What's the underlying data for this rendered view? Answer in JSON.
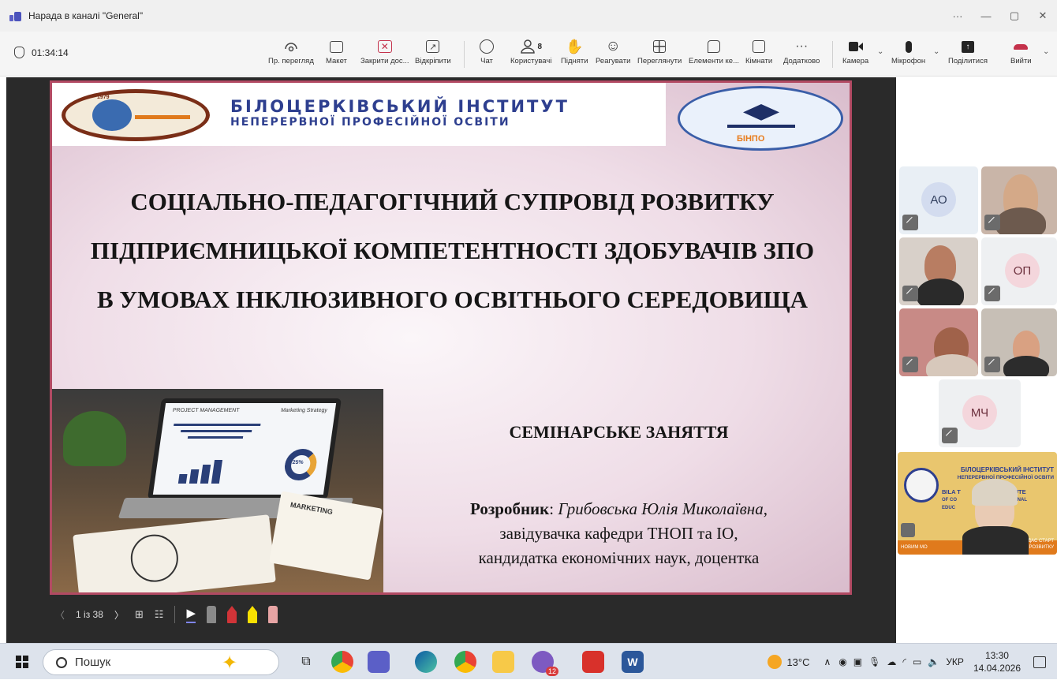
{
  "window": {
    "title": "Нарада в каналі \"General\"",
    "controls": [
      "···",
      "—",
      "▢",
      "✕"
    ]
  },
  "toolbar": {
    "timer": "01:34:14",
    "items": [
      {
        "label": "Пр. перегляд",
        "icon": "eye-icon"
      },
      {
        "label": "Макет",
        "icon": "layout-icon"
      },
      {
        "label": "Закрити дос...",
        "icon": "stop-share-icon"
      },
      {
        "label": "Відкріпити",
        "icon": "pop-out-icon"
      },
      {
        "label": "Чат",
        "icon": "chat-icon"
      },
      {
        "label": "Користувачі",
        "icon": "people-icon",
        "count": "8"
      },
      {
        "label": "Підняти",
        "icon": "raise-hand-icon"
      },
      {
        "label": "Реагувати",
        "icon": "smiley-icon"
      },
      {
        "label": "Переглянути",
        "icon": "view-grid-icon"
      },
      {
        "label": "Елементи ке...",
        "icon": "apps-icon"
      },
      {
        "label": "Кімнати",
        "icon": "rooms-icon"
      },
      {
        "label": "Додатково",
        "icon": "more-icon"
      },
      {
        "label": "Камера",
        "icon": "camera-icon"
      },
      {
        "label": "Мікрофон",
        "icon": "microphone-icon"
      },
      {
        "label": "Поділитися",
        "icon": "share-icon"
      },
      {
        "label": "Вийти",
        "icon": "hang-up-icon"
      }
    ]
  },
  "slide": {
    "institute_line1": "БІЛОЦЕРКІВСЬКИЙ ІНСТИТУТ",
    "institute_line2": "НЕПЕРЕРВНОЇ ПРОФЕСІЙНОЇ ОСВІТИ",
    "logo_left_year": "1979",
    "logo_right_text": "БІНПО",
    "title_lines": [
      "СОЦІАЛЬНО-ПЕДАГОГІЧНИЙ СУПРОВІД РОЗВИТКУ",
      "ПІДПРИЄМНИЦЬКОЇ КОМПЕТЕНТНОСТІ ЗДОБУВАЧІВ ЗПО",
      "В УМОВАХ ІНКЛЮЗИВНОГО ОСВІТНЬОГО СЕРЕДОВИЩА"
    ],
    "subtitle": "СЕМІНАРСЬКЕ ЗАНЯТТЯ",
    "author_label": "Розробник",
    "author_name": "Грибовська  Юлія Миколаївна",
    "author_line2": "завідувачка кафедри ТНОП та ІО,",
    "author_line3": "кандидатка економічних наук, доцентка",
    "photo_texts": {
      "screen_title": "PROJECT MANAGEMENT",
      "screen_side": "Marketing Strategy",
      "donut": "25%",
      "card": "MARKETING"
    }
  },
  "slide_nav": {
    "page": "1 із 38"
  },
  "participants": [
    {
      "initials": "АО",
      "type": "avatar",
      "muted": true
    },
    {
      "initials": "",
      "type": "video",
      "muted": true
    },
    {
      "initials": "",
      "type": "video",
      "muted": true
    },
    {
      "initials": "ОП",
      "type": "avatar",
      "muted": true
    },
    {
      "initials": "",
      "type": "video",
      "muted": true
    },
    {
      "initials": "",
      "type": "video",
      "muted": true
    },
    {
      "initials": "МЧ",
      "type": "avatar",
      "muted": true
    }
  ],
  "self_view": {
    "line1": "БІЛОЦЕРКІВСЬКИЙ ІНСТИТУТ",
    "line2": "НЕПЕРЕРВНОЇ ПРОФЕСІЙНОЇ ОСВІТИ",
    "line3": "BILA T",
    "line3b": "INSTITUTE",
    "line4": "OF CO",
    "line4b": "OFESSIONAL",
    "line5": "EDUC",
    "line6": "ДАЄ СТАРТ",
    "line7": "НОВИМ МО",
    "line7b": "РОЗВИТКУ"
  },
  "taskbar": {
    "search_placeholder": "Пошук",
    "weather": "13°C",
    "language": "УКР",
    "time": "13:30",
    "date": "14.04.2026",
    "badge_count": "12"
  },
  "colors": {
    "slide_border": "#b24a63",
    "institute_blue": "#2e3f8f",
    "teams_purple": "#5b5fc7",
    "hangup_red": "#c4314b"
  }
}
